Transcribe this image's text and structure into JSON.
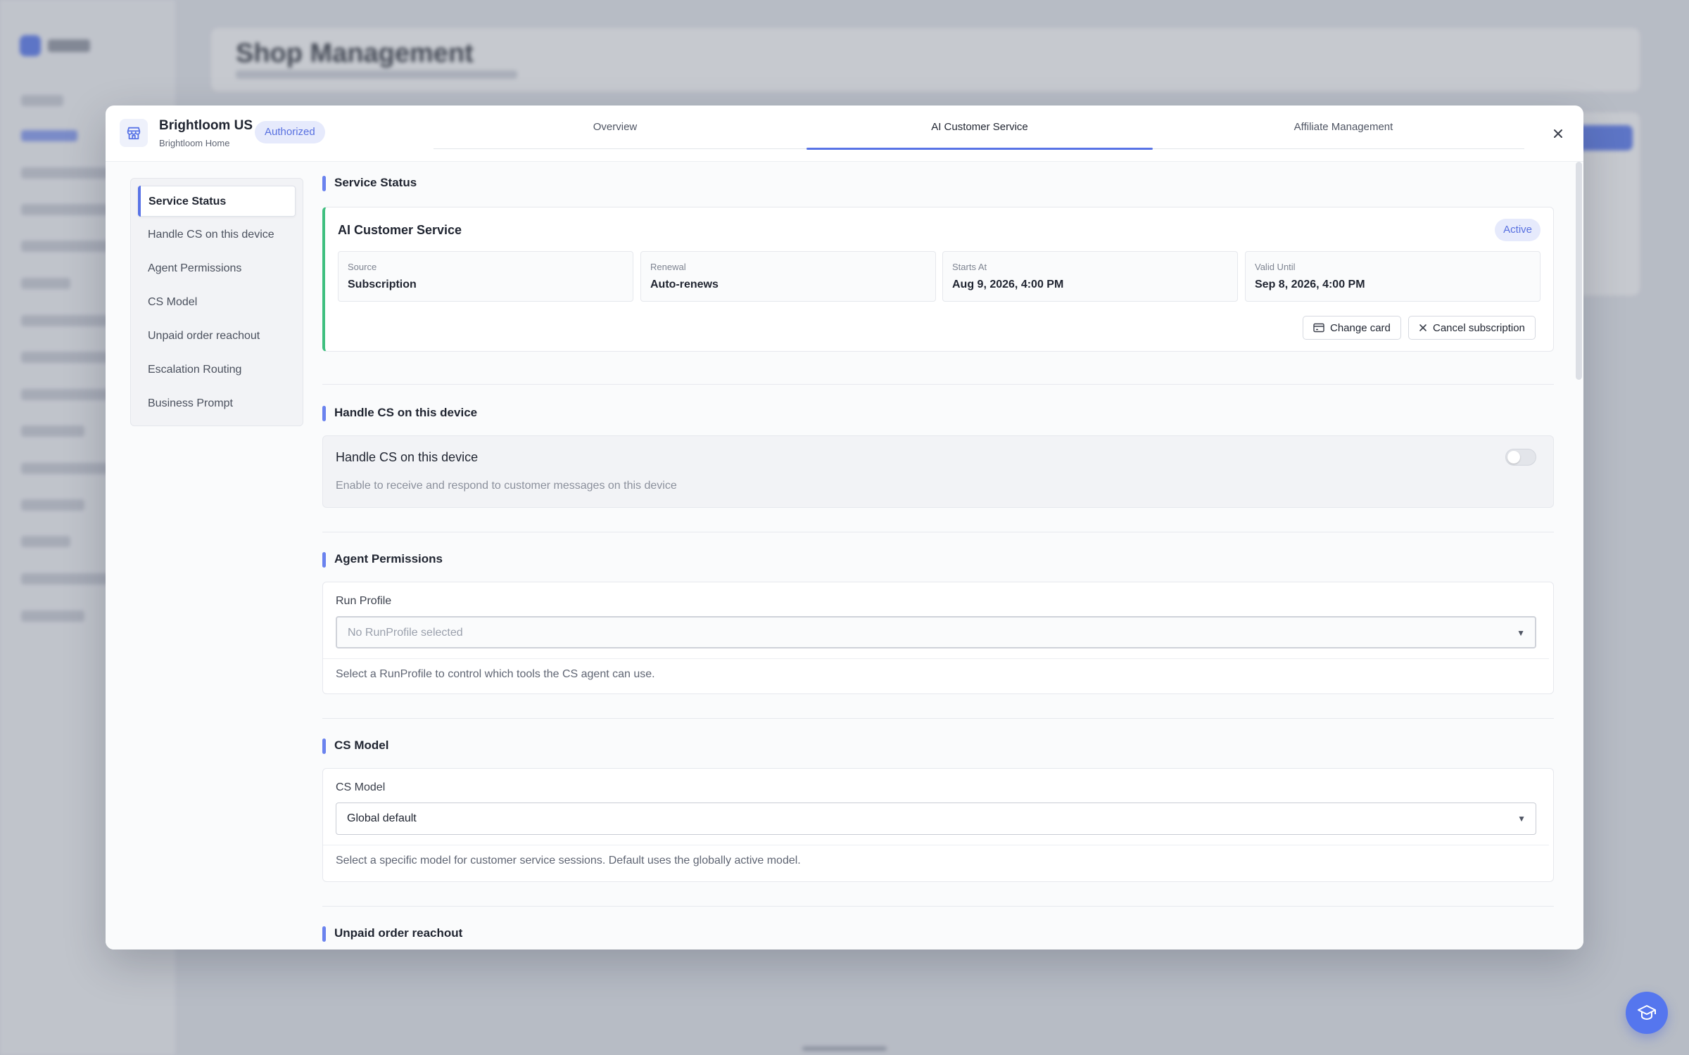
{
  "background": {
    "page_title": "Shop Management"
  },
  "header": {
    "store_name": "Brightloom US",
    "store_subtitle": "Brightloom Home",
    "status_badge": "Authorized",
    "tabs": [
      {
        "label": "Overview"
      },
      {
        "label": "AI Customer Service"
      },
      {
        "label": "Affiliate Management"
      }
    ],
    "active_tab": "AI Customer Service"
  },
  "side_nav": {
    "items": [
      {
        "label": "Service Status"
      },
      {
        "label": "Handle CS on this device"
      },
      {
        "label": "Agent Permissions"
      },
      {
        "label": "CS Model"
      },
      {
        "label": "Unpaid order reachout"
      },
      {
        "label": "Escalation Routing"
      },
      {
        "label": "Business Prompt"
      }
    ],
    "active_item": "Service Status"
  },
  "service_status": {
    "section_title": "Service Status",
    "card_title": "AI Customer Service",
    "badge": "Active",
    "fields": [
      {
        "label": "Source",
        "value": "Subscription"
      },
      {
        "label": "Renewal",
        "value": "Auto-renews"
      },
      {
        "label": "Starts At",
        "value": "Aug 9, 2026, 4:00 PM"
      },
      {
        "label": "Valid Until",
        "value": "Sep 8, 2026, 4:00 PM"
      }
    ],
    "change_card_label": "Change card",
    "cancel_label": "Cancel subscription"
  },
  "handle_cs": {
    "section_title": "Handle CS on this device",
    "label": "Handle CS on this device",
    "description": "Enable to receive and respond to customer messages on this device",
    "enabled": false
  },
  "agent_permissions": {
    "section_title": "Agent Permissions",
    "field_label": "Run Profile",
    "placeholder": "No RunProfile selected",
    "help": "Select a RunProfile to control which tools the CS agent can use."
  },
  "cs_model": {
    "section_title": "CS Model",
    "field_label": "CS Model",
    "value": "Global default",
    "help": "Select a specific model for customer service sessions. Default uses the globally active model."
  },
  "unpaid_reachout": {
    "section_title": "Unpaid order reachout"
  },
  "colors": {
    "accent": "#5873e6",
    "active_green": "#3fbf7f",
    "badge_bg": "#e6eafc"
  },
  "icons": {
    "store": "store-icon",
    "close": "close-icon",
    "card": "credit-card-icon",
    "cancel": "x-icon",
    "help": "graduation-cap-icon"
  }
}
